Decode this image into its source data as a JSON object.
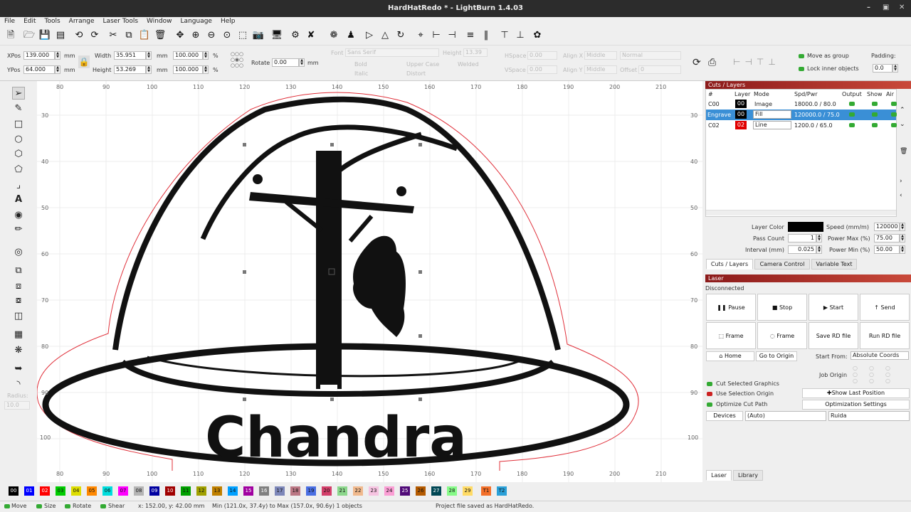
{
  "window": {
    "title": "HardHatRedo * - LightBurn 1.4.03"
  },
  "menu": [
    "File",
    "Edit",
    "Tools",
    "Arrange",
    "Laser Tools",
    "Window",
    "Language",
    "Help"
  ],
  "props": {
    "xpos_label": "XPos",
    "xpos": "139.000",
    "ypos_label": "YPos",
    "ypos": "64.000",
    "mm": "mm",
    "width_label": "Width",
    "width": "35.951",
    "height_label": "Height",
    "height": "53.269",
    "wpct": "100.000",
    "hpct": "100.000",
    "pct": "%",
    "rotate_label": "Rotate",
    "rotate": "0.00",
    "font_label": "Font",
    "font": "Sans Serif",
    "height2_label": "Height",
    "height2": "13.39",
    "hspace_label": "HSpace",
    "hspace": "0.00",
    "vspace_label": "VSpace",
    "vspace": "0.00",
    "alignx_label": "Align X",
    "alignx": "Middle",
    "aligny_label": "Align Y",
    "aligny": "Middle",
    "normal": "Normal",
    "offset_label": "Offset",
    "offset": "0",
    "bold": "Bold",
    "italic": "Italic",
    "upper": "Upper Case",
    "distort": "Distort",
    "welded": "Welded",
    "move_group": "Move as group",
    "lock_inner": "Lock inner objects",
    "padding_label": "Padding:",
    "padding": "0.0"
  },
  "left_tools": {
    "radius_label": "Radius:",
    "radius": "10.0"
  },
  "rulers": {
    "top": [
      "80",
      "90",
      "100",
      "110",
      "120",
      "130",
      "140",
      "150",
      "160",
      "170",
      "180",
      "190",
      "200",
      "210"
    ],
    "left": [
      "30",
      "40",
      "50",
      "60",
      "70",
      "80",
      "90",
      "100"
    ]
  },
  "design": {
    "text": "Chandra"
  },
  "cuts": {
    "title": "Cuts / Layers",
    "headers": [
      "#",
      "Layer",
      "Mode",
      "Spd/Pwr",
      "Output",
      "Show",
      "Air"
    ],
    "rows": [
      {
        "id": "C00",
        "layer": "00",
        "mode": "Image",
        "spd": "18000.0 / 80.0",
        "color": "#000000"
      },
      {
        "id": "Engrave",
        "layer": "00",
        "mode": "Fill",
        "spd": "120000.0 / 75.0",
        "color": "#000000"
      },
      {
        "id": "C02",
        "layer": "02",
        "mode": "Line",
        "spd": "1200.0 / 65.0",
        "color": "#e00000"
      }
    ],
    "layer_color_label": "Layer Color",
    "speed_label": "Speed (mm/m)",
    "speed": "120000",
    "pass_label": "Pass Count",
    "pass": "1",
    "pmax_label": "Power Max (%)",
    "pmax": "75.00",
    "interval_label": "Interval (mm)",
    "interval": "0.025",
    "pmin_label": "Power Min (%)",
    "pmin": "50.00",
    "tabs": [
      "Cuts / Layers",
      "Camera Control",
      "Variable Text"
    ]
  },
  "laser": {
    "title": "Laser",
    "status": "Disconnected",
    "pause": "Pause",
    "stop": "Stop",
    "start": "Start",
    "send": "Send",
    "frame1": "Frame",
    "frame2": "Frame",
    "save_rd": "Save RD file",
    "run_rd": "Run RD file",
    "home": "Home",
    "go_origin": "Go to Origin",
    "start_from_label": "Start From:",
    "start_from": "Absolute Coords",
    "job_origin": "Job Origin",
    "cut_selected": "Cut Selected Graphics",
    "use_sel_origin": "Use Selection Origin",
    "show_last": "Show Last Position",
    "optimize": "Optimize Cut Path",
    "opt_settings": "Optimization Settings",
    "devices": "Devices",
    "auto": "(Auto)",
    "ruida": "Ruida",
    "tabs": [
      "Laser",
      "Library"
    ]
  },
  "palette": [
    {
      "l": "00",
      "c": "#000000"
    },
    {
      "l": "01",
      "c": "#0000ff"
    },
    {
      "l": "02",
      "c": "#ff0000"
    },
    {
      "l": "03",
      "c": "#00cc00"
    },
    {
      "l": "04",
      "c": "#dddd00"
    },
    {
      "l": "05",
      "c": "#ff8800"
    },
    {
      "l": "06",
      "c": "#00dddd"
    },
    {
      "l": "07",
      "c": "#ff00ff"
    },
    {
      "l": "08",
      "c": "#b4b4b4"
    },
    {
      "l": "09",
      "c": "#0000a0"
    },
    {
      "l": "10",
      "c": "#a00000"
    },
    {
      "l": "11",
      "c": "#00a000"
    },
    {
      "l": "12",
      "c": "#a0a000"
    },
    {
      "l": "13",
      "c": "#c08000"
    },
    {
      "l": "14",
      "c": "#00a0ff"
    },
    {
      "l": "15",
      "c": "#a000a0"
    },
    {
      "l": "16",
      "c": "#808080"
    },
    {
      "l": "17",
      "c": "#7d87b9"
    },
    {
      "l": "18",
      "c": "#bb7784"
    },
    {
      "l": "19",
      "c": "#4a6fe3"
    },
    {
      "l": "20",
      "c": "#d33f6a"
    },
    {
      "l": "21",
      "c": "#8cd78c"
    },
    {
      "l": "22",
      "c": "#f0b98d"
    },
    {
      "l": "23",
      "c": "#f6c4e1"
    },
    {
      "l": "24",
      "c": "#fa9ed4"
    },
    {
      "l": "25",
      "c": "#500a78"
    },
    {
      "l": "26",
      "c": "#b45a00"
    },
    {
      "l": "27",
      "c": "#004754"
    },
    {
      "l": "28",
      "c": "#86fa88"
    },
    {
      "l": "29",
      "c": "#ffdb66"
    },
    {
      "l": "T1",
      "c": "#f36f29"
    },
    {
      "l": "T2",
      "c": "#2aa0d8"
    }
  ],
  "status": {
    "move": "Move",
    "size": "Size",
    "rotate": "Rotate",
    "shear": "Shear",
    "coords": "x: 152.00, y: 42.00 mm",
    "range": "Min (121.0x, 37.4y) to Max (157.0x, 90.6y)  1 objects",
    "saved": "Project file saved as HardHatRedo."
  }
}
